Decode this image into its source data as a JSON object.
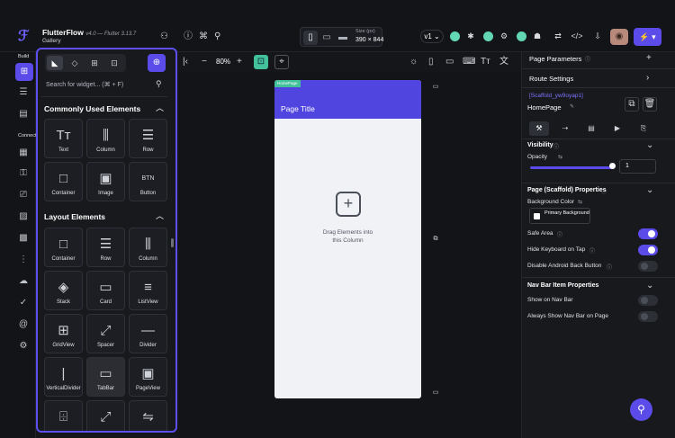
{
  "header": {
    "brand": "FlutterFlow",
    "version": "v4.0 — Flutter 3.13.7",
    "project": "Gallery",
    "size_label": "Size (px)",
    "size_value": "390 × 844",
    "branch": "v1 ⌄"
  },
  "rail": {
    "build_label": "Build",
    "connect_label": "Connect"
  },
  "widget_panel": {
    "search_placeholder": "Search for widget... (⌘ + F)",
    "sections": [
      {
        "title": "Commonly Used Elements",
        "items": [
          "Text",
          "Column",
          "Row",
          "Container",
          "Image",
          "Button"
        ]
      },
      {
        "title": "Layout Elements",
        "items": [
          "Container",
          "Row",
          "Column",
          "Stack",
          "Card",
          "ListView",
          "GridView",
          "Spacer",
          "Divider",
          "VerticalDivider",
          "TabBar",
          "PageView"
        ]
      }
    ]
  },
  "canvas": {
    "zoom": "80%",
    "page_tag": "HomePage",
    "page_title": "Page Title",
    "drag_hint_line1": "Drag Elements into",
    "drag_hint_line2": "this Column"
  },
  "props": {
    "page_parameters": "Page Parameters",
    "route_settings": "Route Settings",
    "widget_id": "[Scaffold_yw9oyap1]",
    "page_name": "HomePage",
    "visibility": "Visibility",
    "opacity": "Opacity",
    "opacity_value": "1",
    "scaffold_title": "Page (Scaffold) Properties",
    "bg_color": "Background Color",
    "bg_value": "Primary Background",
    "safe_area": "Safe Area",
    "hide_kb": "Hide Keyboard on Tap",
    "disable_back": "Disable Android Back Button",
    "navbar_title": "Nav Bar Item Properties",
    "show_navbar": "Show on Nav Bar",
    "always_navbar": "Always Show Nav Bar on Page"
  },
  "toggles": {
    "safe_area": true,
    "hide_kb": true,
    "disable_back": false,
    "show_navbar": false,
    "always_navbar": false
  },
  "colors": {
    "accent": "#5b4be8",
    "appbar": "#5145e0",
    "check": "#63d6b3"
  }
}
